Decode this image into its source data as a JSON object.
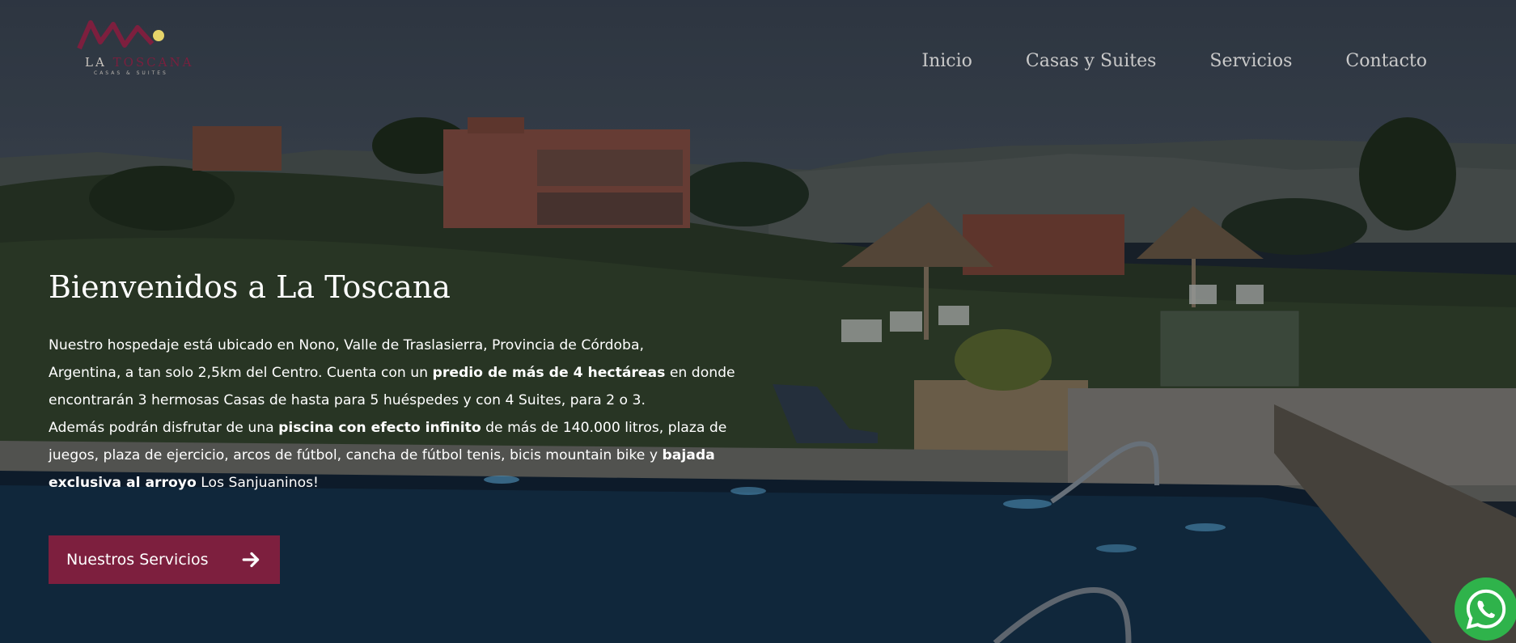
{
  "header": {
    "logo": {
      "text_a": "LA",
      "text_b": "TOSCANA",
      "subtitle": "CASAS & SUITES"
    },
    "nav": [
      {
        "label": "Inicio"
      },
      {
        "label": "Casas y Suites"
      },
      {
        "label": "Servicios"
      },
      {
        "label": "Contacto"
      }
    ]
  },
  "hero": {
    "title": "Bienvenidos a La Toscana",
    "paragraph": {
      "l1": "Nuestro hospedaje está ubicado en Nono, Valle de Traslasierra, Provincia de Córdoba,",
      "l2a": "Argentina, a tan solo 2,5km del Centro. Cuenta con un ",
      "l2b": "predio de más de 4 hectáreas",
      "l2c": " en donde",
      "l3": "encontrarán 3 hermosas Casas de hasta para 5 huéspedes y con 4 Suites, para 2 o 3.",
      "l4a": "Además podrán disfrutar de una ",
      "l4b": "piscina con efecto infinito",
      "l4c": " de más de 140.000 litros, plaza de",
      "l5a": "juegos, plaza de ejercicio, arcos de fútbol, cancha de fútbol tenis, bicis mountain bike y  ",
      "l5b": "bajada",
      "l6a": "exclusiva al arroyo",
      "l6b": " Los Sanjuaninos!"
    },
    "cta_label": "Nuestros Servicios"
  },
  "colors": {
    "brand": "#7d1f3e",
    "whatsapp": "#2fb34b",
    "nav_text": "#c9c9c9"
  },
  "icons": {
    "cta": "arrow-right-icon",
    "whatsapp": "whatsapp-icon"
  }
}
